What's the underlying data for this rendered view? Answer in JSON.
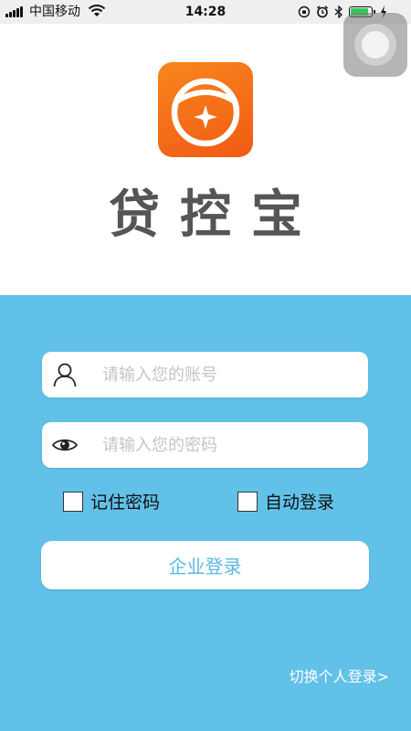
{
  "status_bar": {
    "carrier": "中国移动",
    "time": "14:28",
    "battery_level": 0.85,
    "battery_color": "#35c759"
  },
  "app": {
    "name": "贷控宝",
    "logo_colors": [
      "#f8861e",
      "#f05a14"
    ]
  },
  "login": {
    "account_placeholder": "请输入您的账号",
    "password_placeholder": "请输入您的密码",
    "remember_password_label": "记住密码",
    "auto_login_label": "自动登录",
    "submit_label": "企业登录",
    "switch_label": "切换个人登录>"
  },
  "icons": {
    "account": "user-icon",
    "password": "eye-icon"
  },
  "colors": {
    "panel_bg": "#62c1e9",
    "button_text": "#5ab8e3",
    "placeholder": "#c4c4c4",
    "app_name": "#555558"
  }
}
